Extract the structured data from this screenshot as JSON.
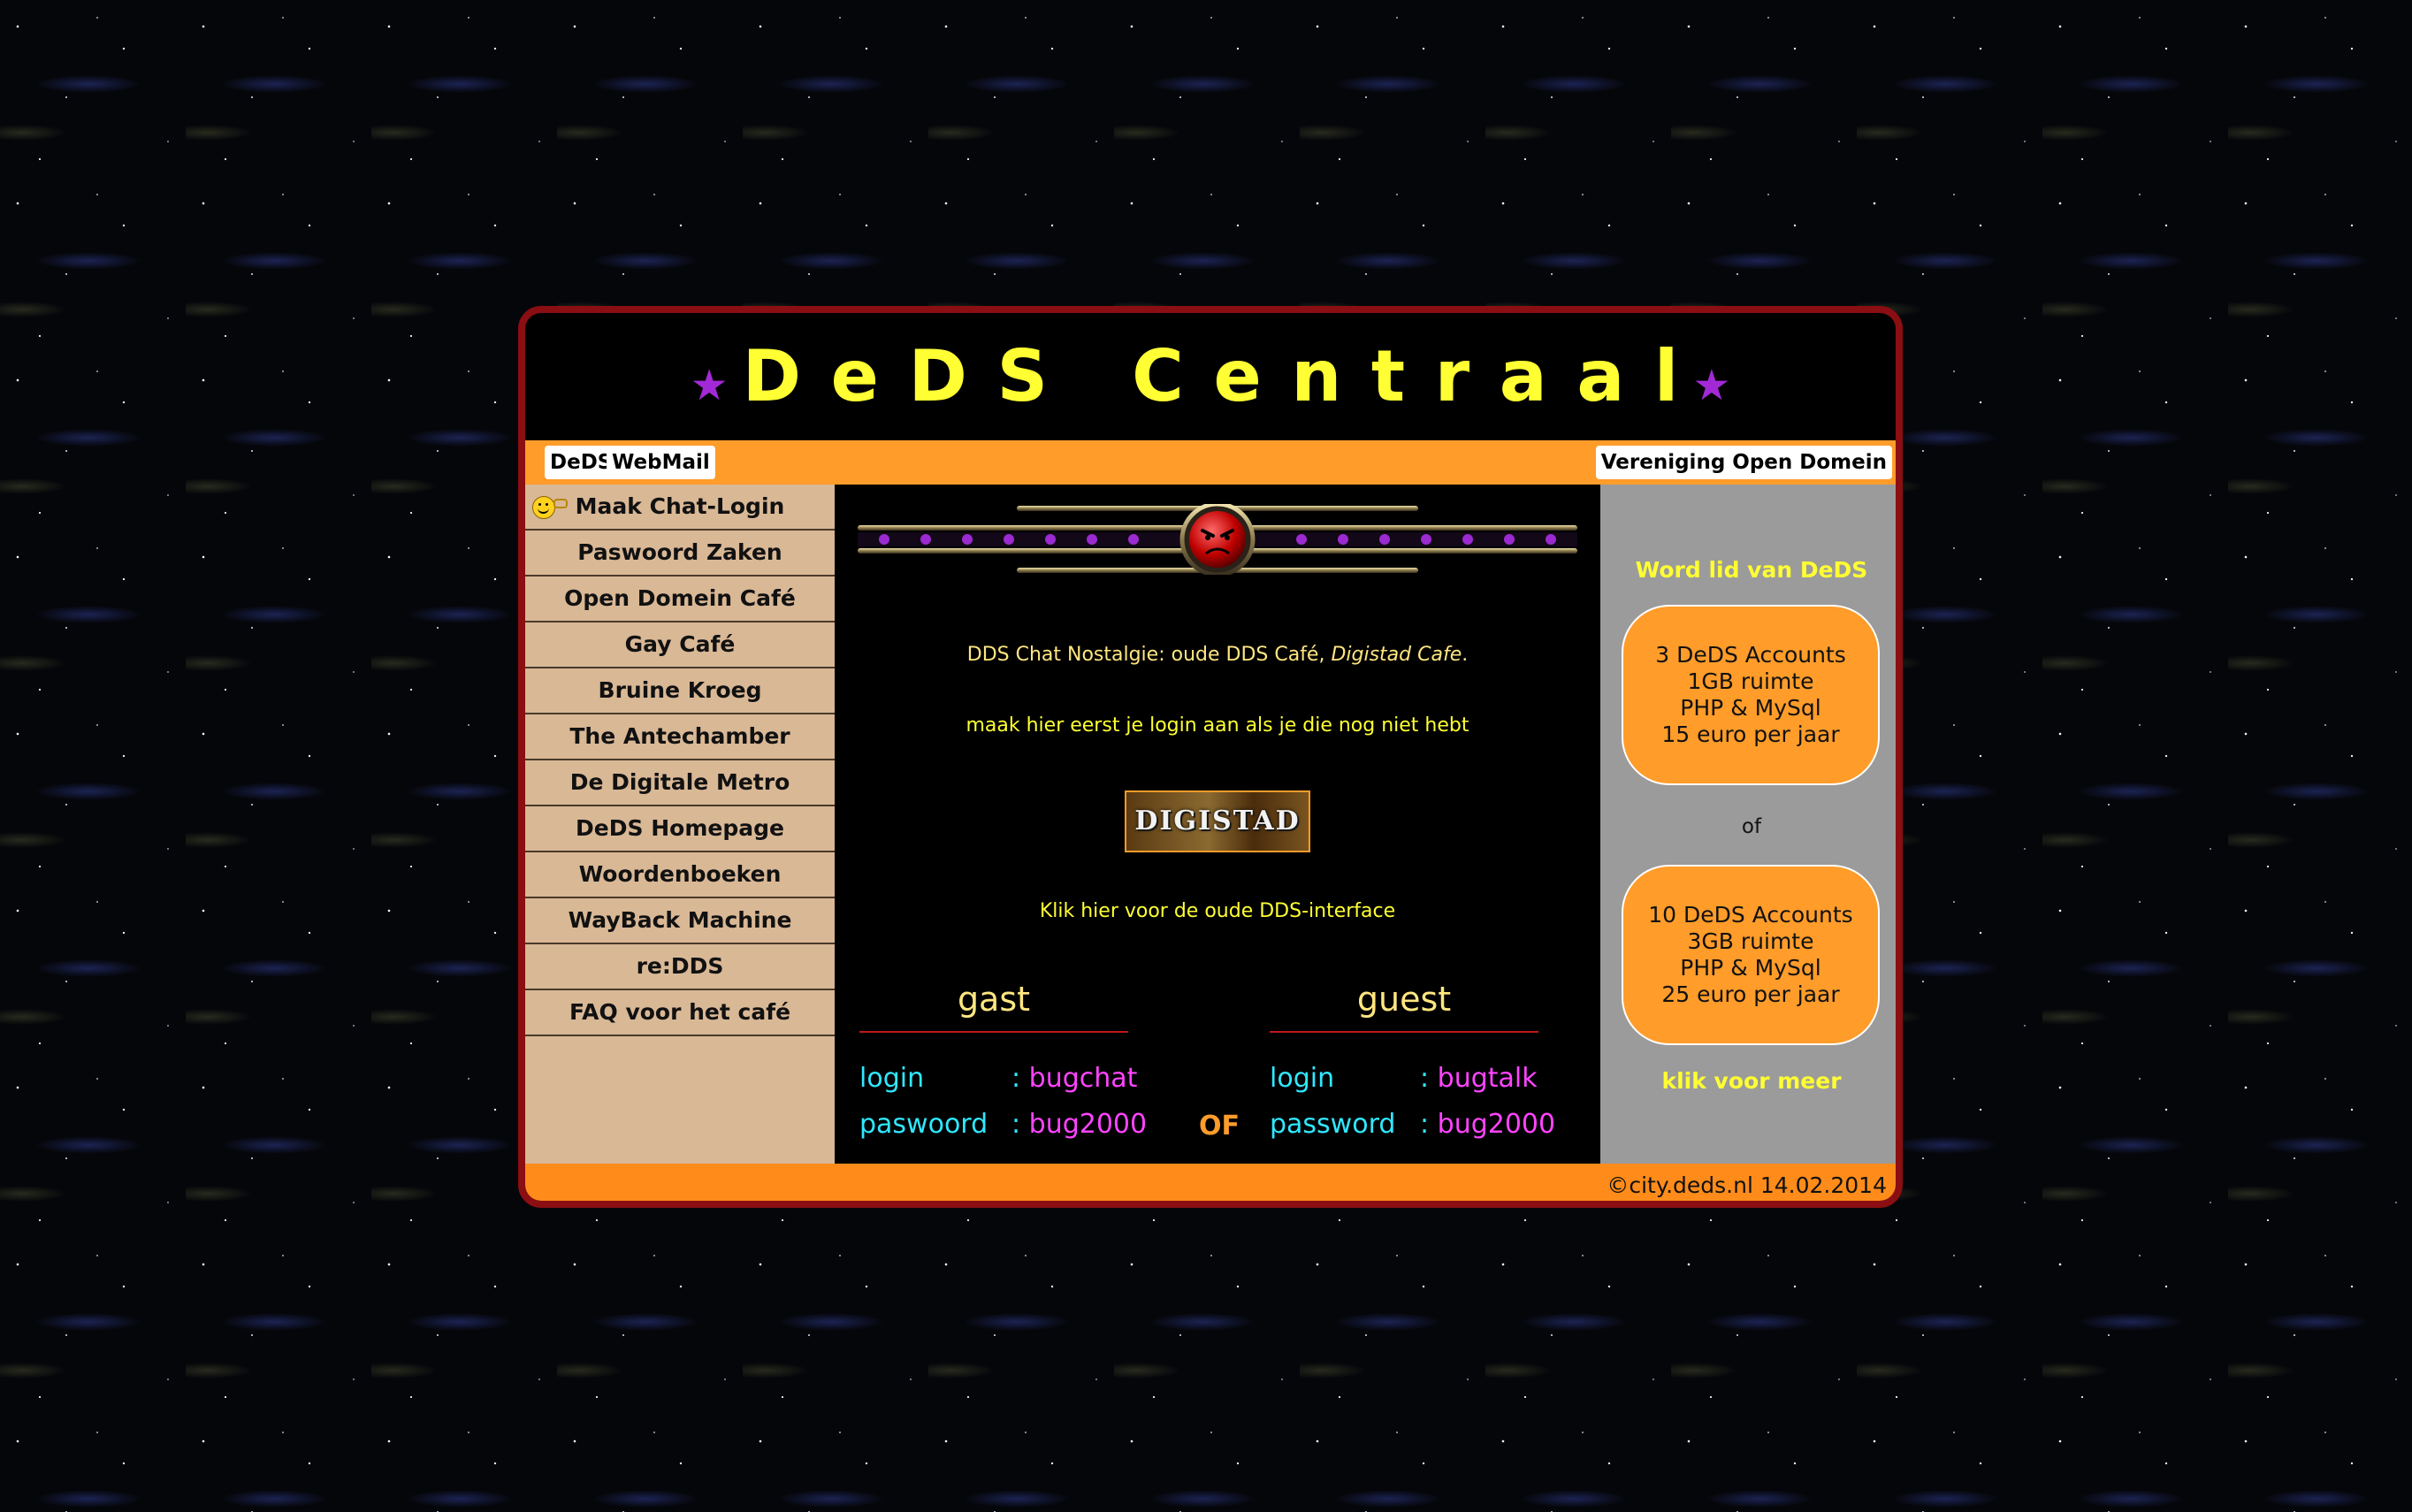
{
  "header": {
    "title": "DeDS Centraal",
    "star_glyph": "★"
  },
  "topbar": {
    "deds_label": "DeDS",
    "webmail_label": "WebMail",
    "vod_label": "Vereniging Open Domein"
  },
  "sidebar": {
    "items": [
      {
        "label": "Maak Chat-Login"
      },
      {
        "label": "Paswoord Zaken"
      },
      {
        "label": "Open Domein Café"
      },
      {
        "label": "Gay Café"
      },
      {
        "label": "Bruine Kroeg"
      },
      {
        "label": "The Antechamber"
      },
      {
        "label": "De Digitale Metro"
      },
      {
        "label": "DeDS Homepage"
      },
      {
        "label": "Woordenboeken"
      },
      {
        "label": "WayBack Machine"
      },
      {
        "label": "re:DDS"
      },
      {
        "label": "FAQ voor het café"
      }
    ]
  },
  "main": {
    "intro_text": "DDS Chat Nostalgie: oude DDS Café, ",
    "intro_italic": "Digistad Cafe",
    "intro_end": ".",
    "login_hint": "maak hier eerst je login aan als je die nog niet hebt",
    "digistad_logo_text": "DIGISTAD",
    "old_interface_link": "Klik hier voor de oude DDS-interface",
    "guest_nl": {
      "title": "gast",
      "login_label": "login",
      "login_value": "bugchat",
      "password_label": "paswoord",
      "password_value": "bug2000"
    },
    "or_label": "OF",
    "guest_en": {
      "title": "guest",
      "login_label": "login",
      "login_value": "bugtalk",
      "password_label": "password",
      "password_value": "bug2000"
    },
    "colon": ":"
  },
  "right": {
    "join_title": "Word lid van DeDS",
    "offer_1": [
      "3 DeDS Accounts",
      "1GB ruimte",
      "PHP & MySql",
      "15 euro per jaar"
    ],
    "or_text": "of",
    "offer_2": [
      "10 DeDS Accounts",
      "3GB ruimte",
      "PHP & MySql",
      "25 euro per jaar"
    ],
    "more_link": "klik voor meer"
  },
  "footer": {
    "copyright": "©city.deds.nl 14.02.2014"
  },
  "colors": {
    "title_yellow": "#ffff33",
    "accent_orange": "#ff9c2a",
    "frame_red": "#8a0e12",
    "nav_tan": "#d9b896",
    "cyan_label": "#2fe8ff",
    "magenta_value": "#ff44ff"
  },
  "icons": [
    "smiley-icon",
    "key-icon",
    "angry-face-icon",
    "star-icon"
  ]
}
